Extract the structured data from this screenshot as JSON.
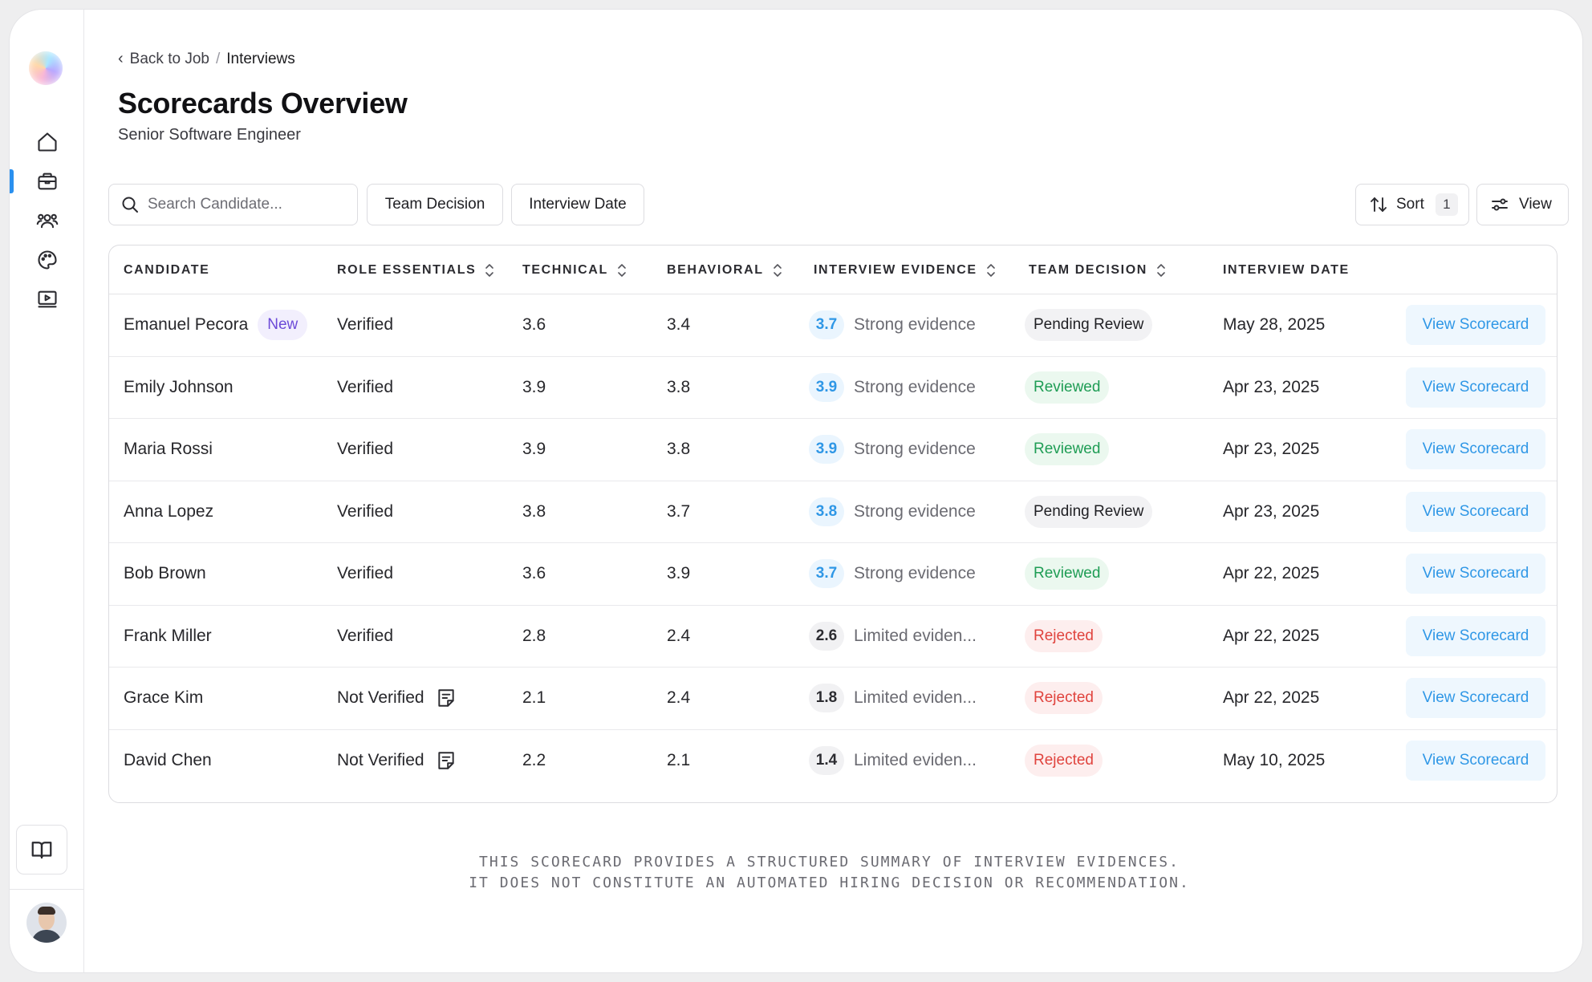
{
  "breadcrumb": {
    "back": "Back to Job",
    "separator": "/",
    "current": "Interviews"
  },
  "page": {
    "title": "Scorecards Overview",
    "subtitle": "Senior Software Engineer"
  },
  "toolbar": {
    "search_placeholder": "Search Candidate...",
    "filter_team": "Team Decision",
    "filter_date": "Interview Date",
    "sort_label": "Sort",
    "sort_count": "1",
    "view_label": "View"
  },
  "sidebar": {
    "items": [
      {
        "name": "home",
        "icon": "home-icon",
        "active": false
      },
      {
        "name": "jobs",
        "icon": "briefcase-icon",
        "active": true
      },
      {
        "name": "team",
        "icon": "users-icon",
        "active": false
      },
      {
        "name": "design",
        "icon": "palette-icon",
        "active": false
      },
      {
        "name": "media",
        "icon": "video-icon",
        "active": false
      }
    ],
    "bottom_icon": "book-open-icon"
  },
  "table": {
    "headers": {
      "candidate": "Candidate",
      "role_essentials": "Role Essentials",
      "technical": "Technical",
      "behavioral": "Behavioral",
      "interview_evidence": "Interview Evidence",
      "team_decision": "Team Decision",
      "interview_date": "Interview Date"
    },
    "action_label": "View Scorecard",
    "new_label": "New",
    "rows": [
      {
        "name": "Emanuel Pecora",
        "is_new": true,
        "role": "Verified",
        "has_note": false,
        "technical": "3.6",
        "behavioral": "3.4",
        "evidence_score": "3.7",
        "evidence_level": "strong",
        "evidence_text": "Strong evidence",
        "decision": "Pending Review",
        "decision_status": "pending",
        "date": "May 28, 2025"
      },
      {
        "name": "Emily Johnson",
        "is_new": false,
        "role": "Verified",
        "has_note": false,
        "technical": "3.9",
        "behavioral": "3.8",
        "evidence_score": "3.9",
        "evidence_level": "strong",
        "evidence_text": "Strong evidence",
        "decision": "Reviewed",
        "decision_status": "reviewed",
        "date": "Apr 23, 2025"
      },
      {
        "name": "Maria Rossi",
        "is_new": false,
        "role": "Verified",
        "has_note": false,
        "technical": "3.9",
        "behavioral": "3.8",
        "evidence_score": "3.9",
        "evidence_level": "strong",
        "evidence_text": "Strong evidence",
        "decision": "Reviewed",
        "decision_status": "reviewed",
        "date": "Apr 23, 2025"
      },
      {
        "name": "Anna Lopez",
        "is_new": false,
        "role": "Verified",
        "has_note": false,
        "technical": "3.8",
        "behavioral": "3.7",
        "evidence_score": "3.8",
        "evidence_level": "strong",
        "evidence_text": "Strong evidence",
        "decision": "Pending Review",
        "decision_status": "pending",
        "date": "Apr 23, 2025"
      },
      {
        "name": "Bob Brown",
        "is_new": false,
        "role": "Verified",
        "has_note": false,
        "technical": "3.6",
        "behavioral": "3.9",
        "evidence_score": "3.7",
        "evidence_level": "strong",
        "evidence_text": "Strong evidence",
        "decision": "Reviewed",
        "decision_status": "reviewed",
        "date": "Apr 22, 2025"
      },
      {
        "name": "Frank Miller",
        "is_new": false,
        "role": "Verified",
        "has_note": false,
        "technical": "2.8",
        "behavioral": "2.4",
        "evidence_score": "2.6",
        "evidence_level": "limited",
        "evidence_text": "Limited eviden...",
        "decision": "Rejected",
        "decision_status": "rejected",
        "date": "Apr 22, 2025"
      },
      {
        "name": "Grace Kim",
        "is_new": false,
        "role": "Not Verified",
        "has_note": true,
        "technical": "2.1",
        "behavioral": "2.4",
        "evidence_score": "1.8",
        "evidence_level": "limited",
        "evidence_text": "Limited eviden...",
        "decision": "Rejected",
        "decision_status": "rejected",
        "date": "Apr 22, 2025"
      },
      {
        "name": "David Chen",
        "is_new": false,
        "role": "Not Verified",
        "has_note": true,
        "technical": "2.2",
        "behavioral": "2.1",
        "evidence_score": "1.4",
        "evidence_level": "limited",
        "evidence_text": "Limited eviden...",
        "decision": "Rejected",
        "decision_status": "rejected",
        "date": "May 10, 2025"
      }
    ]
  },
  "disclaimer": {
    "line1": "This scorecard provides a structured summary of interview evidences.",
    "line2": "It does not constitute an automated hiring decision or recommendation."
  },
  "colors": {
    "accent": "#2a90ef",
    "strong_evidence": "#2f97e6",
    "reviewed": "#1f9d55",
    "rejected": "#e0443e",
    "new_badge": "#6c4ad8"
  }
}
